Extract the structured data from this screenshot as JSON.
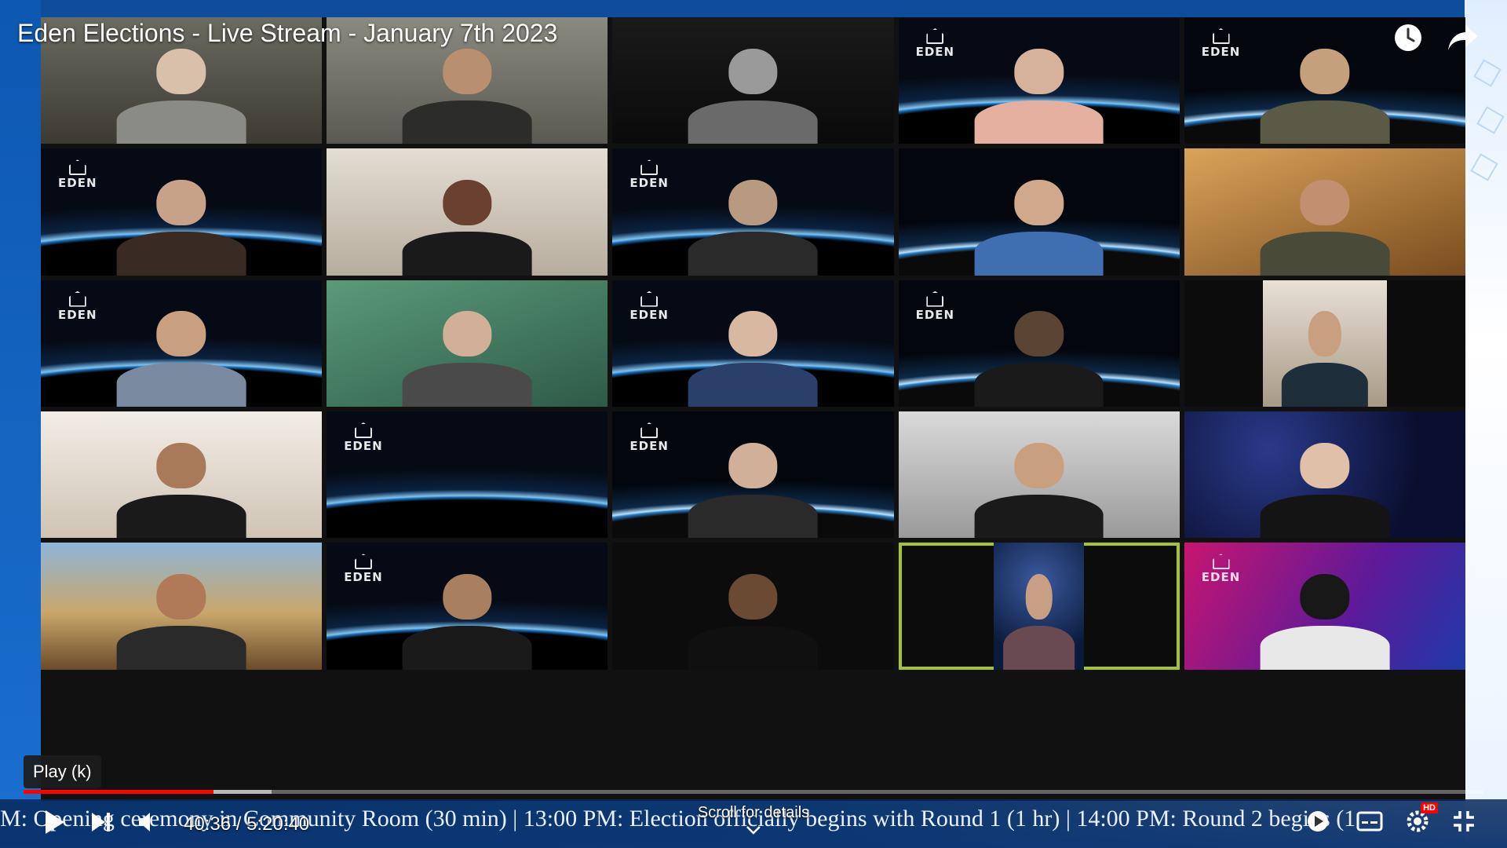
{
  "video": {
    "title": "Eden Elections - Live Stream - January 7th 2023",
    "tooltip": "Play (k)",
    "time_current": "40:36",
    "time_separator": "/",
    "time_total": "5:20:40",
    "scroll_hint": "Scroll for details",
    "ticker": "M: Opening ceremony in Community Room (30 min)  | 13:00 PM: Election officially begins with Round 1 (1 hr) | 14:00 PM: Round 2 begins (1",
    "progress_played_percent": 13,
    "hd_badge": "HD"
  },
  "logos": {
    "eden": "EDEN"
  },
  "colors": {
    "accent_red": "#ff0000",
    "highlight_green": "#a5c62b",
    "brand_blue": "#1a78d6"
  }
}
